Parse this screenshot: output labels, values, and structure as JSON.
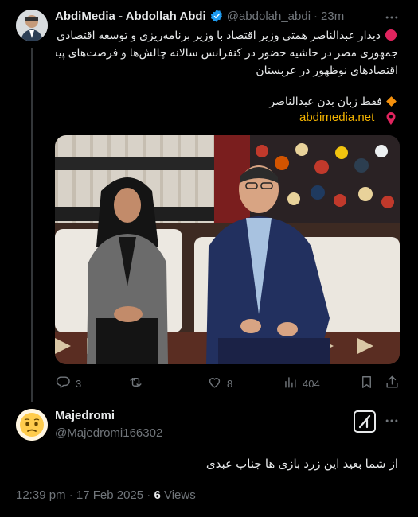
{
  "tweet": {
    "author_name": "AbdiMedia - Abdollah Abdi",
    "handle": "@abdolah_abdi",
    "sep": "·",
    "time": "23m",
    "line1": "دیدار عبدالناصر همتی وزیر اقتصاد با وزیر برنامه‌ریزی و توسعه اقتصادی",
    "line2": "جمهوری مصر در حاشیه حضور در کنفرانس سالانه چالش‌ها و فرصت‌های پیش روی",
    "line3": "اقتصادهای نوظهور در عربستان",
    "line4": "فقط زبان بدن عبدالناصر",
    "link": "abdimedia.net",
    "reply_count": "3",
    "retweet_count": "",
    "like_count": "8",
    "views_count": "404"
  },
  "reply": {
    "author_name": "Majedromi",
    "handle": "@Majedromi166302",
    "text": "از شما بعید این زرد بازی ها جناب عبدی",
    "timestamp": "12:39 pm · 17 Feb 2025 ·",
    "views_number": "6",
    "views_label": "Views"
  },
  "colors": {
    "background": "#000000",
    "text": "#e7e9ea",
    "muted": "#71767b",
    "verified": "#1d9bf0",
    "link": "#f4b400"
  },
  "icons": [
    "red-circle-icon",
    "orange-diamond-icon",
    "pin-icon",
    "verified-icon",
    "more-icon",
    "reply-icon",
    "retweet-icon",
    "like-icon",
    "views-icon",
    "bookmark-icon",
    "share-icon",
    "grok-icon"
  ]
}
